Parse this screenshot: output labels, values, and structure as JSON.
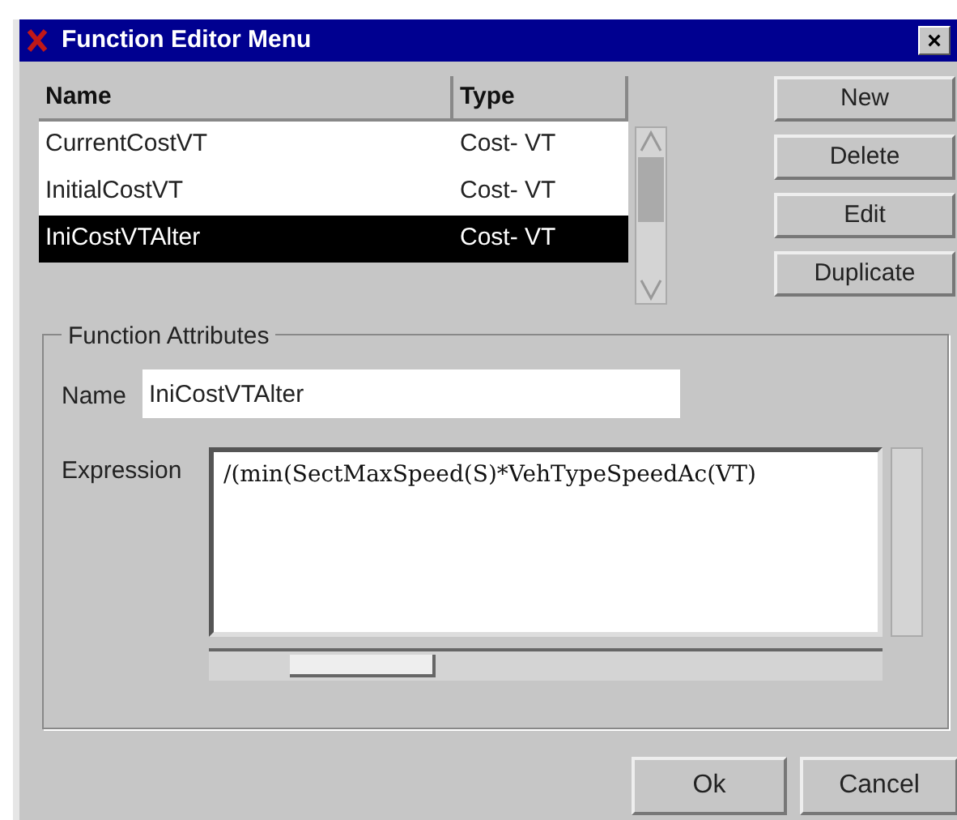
{
  "window": {
    "title": "Function Editor Menu",
    "close": "×"
  },
  "table": {
    "columns": [
      "Name",
      "Type"
    ],
    "rows": [
      {
        "name": "CurrentCostVT",
        "type": "Cost- VT",
        "selected": false
      },
      {
        "name": "InitialCostVT",
        "type": "Cost- VT",
        "selected": false
      },
      {
        "name": "IniCostVTAlter",
        "type": "Cost- VT",
        "selected": true
      }
    ]
  },
  "side_buttons": [
    "New",
    "Delete",
    "Edit",
    "Duplicate"
  ],
  "attributes": {
    "legend": "Function Attributes",
    "name_label": "Name",
    "name_value": "IniCostVTAlter",
    "expression_label": "Expression",
    "expression": "/(min(SectMaxSpeed(S)*VehTypeSpeedAc(VT)"
  },
  "buttons": [
    "Ok",
    "Cancel"
  ]
}
